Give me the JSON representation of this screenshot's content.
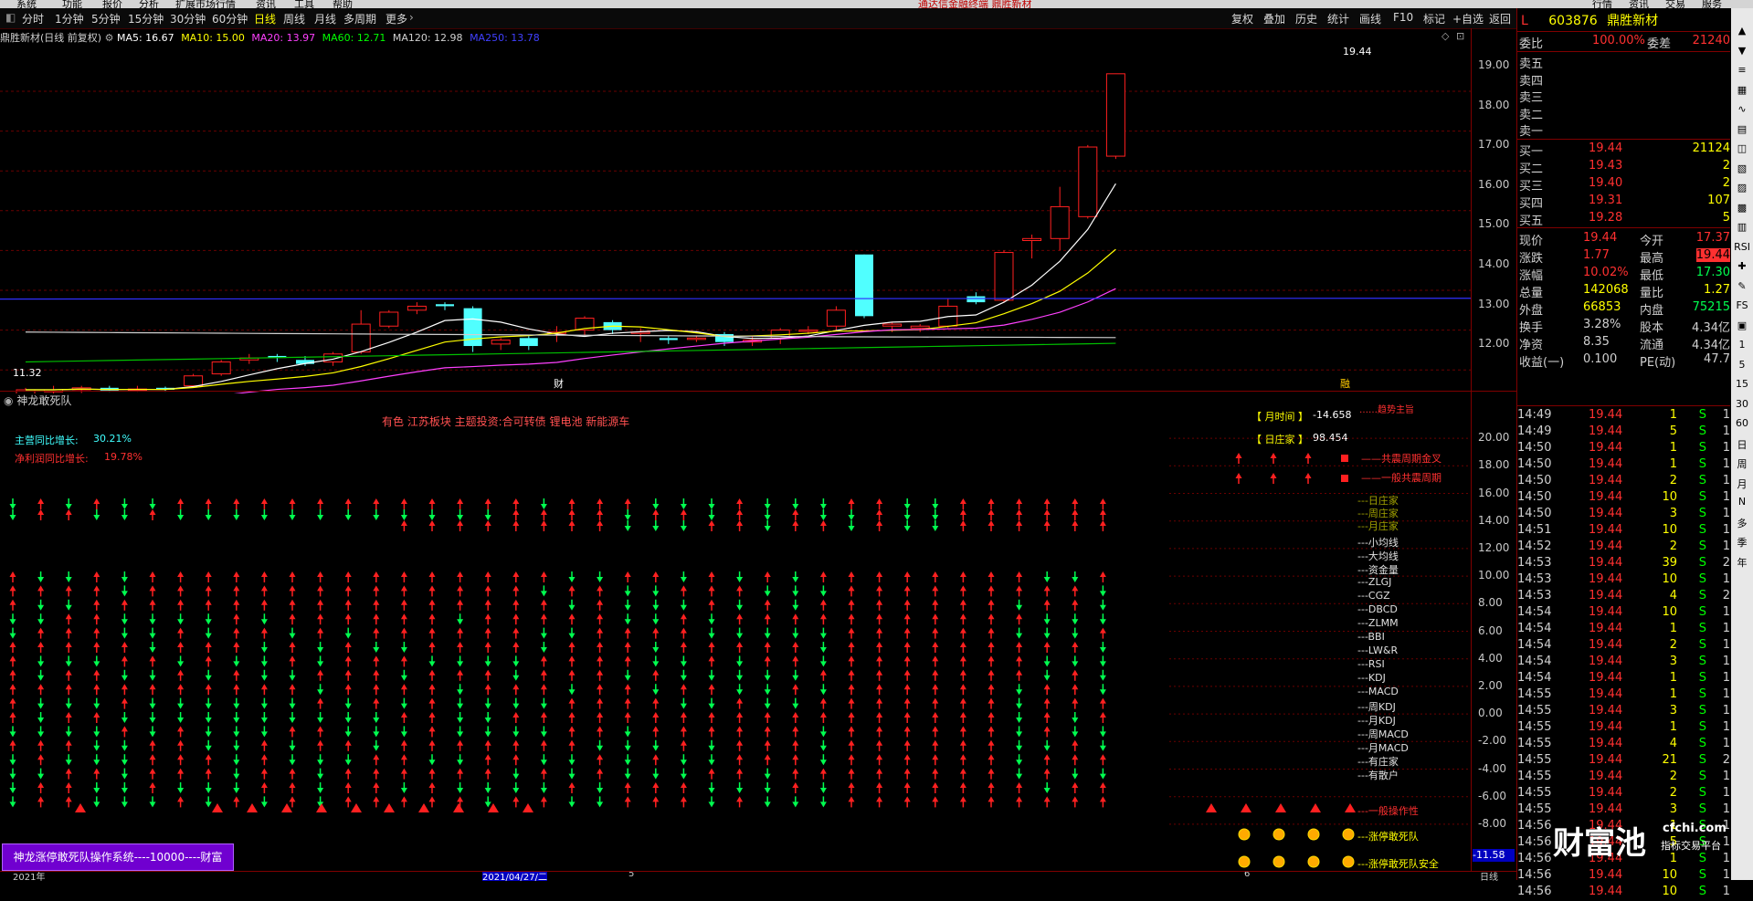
{
  "menu": [
    "系统",
    "功能",
    "报价",
    "分析",
    "扩展市场行情",
    "资讯",
    "工具",
    "帮助"
  ],
  "menu_center": "通达信金融终端 鼎胜新材",
  "menu_right": [
    "行情",
    "资讯",
    "交易",
    "服务"
  ],
  "toolbar": {
    "periods": [
      "分时",
      "1分钟",
      "5分钟",
      "15分钟",
      "30分钟",
      "60分钟",
      "日线",
      "周线",
      "月线",
      "多周期",
      "更多"
    ],
    "active": "日线",
    "right_buttons": [
      "复权",
      "叠加",
      "历史",
      "统计",
      "画线",
      "F10",
      "标记",
      "+自选",
      "返回"
    ]
  },
  "chart_header": {
    "title": "鼎胜新材(日线 前复权)",
    "ma": [
      {
        "label": "MA5: 16.67",
        "color": "#ffffff"
      },
      {
        "label": "MA10: 15.00",
        "color": "#ffff00"
      },
      {
        "label": "MA20: 13.97",
        "color": "#ff40ff"
      },
      {
        "label": "MA60: 12.71",
        "color": "#00ff00"
      },
      {
        "label": "MA120: 12.98",
        "color": "#d0d0d0"
      },
      {
        "label": "MA250: 13.78",
        "color": "#4040ff"
      }
    ]
  },
  "stock": {
    "code": "603876",
    "name": "鼎胜新材",
    "flag": "L"
  },
  "quote": {
    "weibi_label": "委比",
    "weibi": "100.00%",
    "weicha_label": "委差",
    "weicha": "21240",
    "sells": [
      {
        "label": "卖五"
      },
      {
        "label": "卖四"
      },
      {
        "label": "卖三"
      },
      {
        "label": "卖二"
      },
      {
        "label": "卖一"
      }
    ],
    "buys": [
      {
        "label": "买一",
        "price": "19.44",
        "vol": "21124"
      },
      {
        "label": "买二",
        "price": "19.43",
        "vol": "2"
      },
      {
        "label": "买三",
        "price": "19.40",
        "vol": "2"
      },
      {
        "label": "买四",
        "price": "19.31",
        "vol": "107"
      },
      {
        "label": "买五",
        "price": "19.28",
        "vol": "5"
      }
    ],
    "stats": [
      {
        "l1": "现价",
        "v1": "19.44",
        "l2": "今开",
        "v2": "17.37"
      },
      {
        "l1": "涨跌",
        "v1": "1.77",
        "l2": "最高",
        "v2": "19.44"
      },
      {
        "l1": "涨幅",
        "v1": "10.02%",
        "l2": "最低",
        "v2": "17.30"
      },
      {
        "l1": "总量",
        "v1": "142068",
        "l2": "量比",
        "v2": "1.27"
      },
      {
        "l1": "外盘",
        "v1": "66853",
        "l2": "内盘",
        "v2": "75215"
      },
      {
        "l1": "换手",
        "v1": "3.28%",
        "l2": "股本",
        "v2": "4.34亿"
      },
      {
        "l1": "净资",
        "v1": "8.35",
        "l2": "流通",
        "v2": "4.34亿"
      },
      {
        "l1": "收益(一)",
        "v1": "0.100",
        "l2": "PE(动)",
        "v2": "47.7"
      }
    ]
  },
  "ticks": [
    {
      "t": "14:49",
      "p": "19.44",
      "q": "1",
      "s": "S",
      "n": "1"
    },
    {
      "t": "14:49",
      "p": "19.44",
      "q": "5",
      "s": "S",
      "n": "1"
    },
    {
      "t": "14:50",
      "p": "19.44",
      "q": "1",
      "s": "S",
      "n": "1"
    },
    {
      "t": "14:50",
      "p": "19.44",
      "q": "1",
      "s": "S",
      "n": "1"
    },
    {
      "t": "14:50",
      "p": "19.44",
      "q": "2",
      "s": "S",
      "n": "1"
    },
    {
      "t": "14:50",
      "p": "19.44",
      "q": "10",
      "s": "S",
      "n": "1"
    },
    {
      "t": "14:50",
      "p": "19.44",
      "q": "3",
      "s": "S",
      "n": "1"
    },
    {
      "t": "14:51",
      "p": "19.44",
      "q": "10",
      "s": "S",
      "n": "1"
    },
    {
      "t": "14:52",
      "p": "19.44",
      "q": "2",
      "s": "S",
      "n": "1"
    },
    {
      "t": "14:53",
      "p": "19.44",
      "q": "39",
      "s": "S",
      "n": "2"
    },
    {
      "t": "14:53",
      "p": "19.44",
      "q": "10",
      "s": "S",
      "n": "1"
    },
    {
      "t": "14:53",
      "p": "19.44",
      "q": "4",
      "s": "S",
      "n": "2"
    },
    {
      "t": "14:54",
      "p": "19.44",
      "q": "10",
      "s": "S",
      "n": "1"
    },
    {
      "t": "14:54",
      "p": "19.44",
      "q": "1",
      "s": "S",
      "n": "1"
    },
    {
      "t": "14:54",
      "p": "19.44",
      "q": "2",
      "s": "S",
      "n": "1"
    },
    {
      "t": "14:54",
      "p": "19.44",
      "q": "3",
      "s": "S",
      "n": "1"
    },
    {
      "t": "14:54",
      "p": "19.44",
      "q": "1",
      "s": "S",
      "n": "1"
    },
    {
      "t": "14:55",
      "p": "19.44",
      "q": "1",
      "s": "S",
      "n": "1"
    },
    {
      "t": "14:55",
      "p": "19.44",
      "q": "3",
      "s": "S",
      "n": "1"
    },
    {
      "t": "14:55",
      "p": "19.44",
      "q": "1",
      "s": "S",
      "n": "1"
    },
    {
      "t": "14:55",
      "p": "19.44",
      "q": "4",
      "s": "S",
      "n": "1"
    },
    {
      "t": "14:55",
      "p": "19.44",
      "q": "21",
      "s": "S",
      "n": "2"
    },
    {
      "t": "14:55",
      "p": "19.44",
      "q": "2",
      "s": "S",
      "n": "1"
    },
    {
      "t": "14:55",
      "p": "19.44",
      "q": "2",
      "s": "S",
      "n": "1"
    },
    {
      "t": "14:55",
      "p": "19.44",
      "q": "3",
      "s": "S",
      "n": "1"
    },
    {
      "t": "14:56",
      "p": "19.44",
      "q": "1",
      "s": "S",
      "n": "1"
    },
    {
      "t": "14:56",
      "p": "19.44",
      "q": "5",
      "s": "S",
      "n": "1"
    },
    {
      "t": "14:56",
      "p": "19.44",
      "q": "1",
      "s": "S",
      "n": "1"
    },
    {
      "t": "14:56",
      "p": "19.44",
      "q": "10",
      "s": "S",
      "n": "1"
    },
    {
      "t": "14:56",
      "p": "19.44",
      "q": "10",
      "s": "S",
      "n": "1"
    }
  ],
  "sidebar_icons": [
    "▲",
    "▼",
    "≡",
    "▦",
    "∿",
    "▤",
    "◫",
    "▧",
    "▨",
    "▩",
    "▥",
    "RSI",
    "✚",
    "✎",
    "FS",
    "▣",
    "1",
    "5",
    "15",
    "30",
    "60",
    "日",
    "周",
    "月",
    "N",
    "多",
    "季",
    "年"
  ],
  "price_axis": [
    "19.00",
    "18.00",
    "17.00",
    "16.00",
    "15.00",
    "14.00",
    "13.00",
    "12.00"
  ],
  "price_labels": {
    "high": "19.44",
    "low": "11.32",
    "cai": "财",
    "rong": "融"
  },
  "indicator": {
    "title": "神龙敢死队",
    "concepts": "有色 江苏板块 主题投资:合可转债 锂电池 新能源车",
    "yoy_main_label": "主营同比增长:",
    "yoy_main": "30.21%",
    "yoy_profit_label": "净利润同比增长:",
    "yoy_profit": "19.78%",
    "month_time_label": "【 月时间 】",
    "month_time": "-14.658",
    "day_zhuang_label": "【 日庄家 】",
    "day_zhuang": "98.454",
    "top_label": "……趋势主旨",
    "bottom_value": "-11.58",
    "banner": "神龙涨停敢死队操作系统----10000----财富"
  },
  "indicator_axis": [
    "20.00",
    "18.00",
    "16.00",
    "14.00",
    "12.00",
    "10.00",
    "8.00",
    "6.00",
    "4.00",
    "2.00",
    "0.00",
    "-2.00",
    "-4.00",
    "-6.00",
    "-8.00"
  ],
  "legend_rows": [
    {
      "text": "——共震周期金叉",
      "color": "#ff3030"
    },
    {
      "text": "——一般共震周期",
      "color": "#ff3030"
    },
    {
      "text": "---日庄家",
      "color": "#a0a000"
    },
    {
      "text": "---周庄家",
      "color": "#a0a000"
    },
    {
      "text": "---月庄家",
      "color": "#a0a000"
    },
    {
      "text": "---小均线",
      "color": "#e0e0e0"
    },
    {
      "text": "---大均线",
      "color": "#e0e0e0"
    },
    {
      "text": "---资金量",
      "color": "#e0e0e0"
    },
    {
      "text": "---ZLGJ",
      "color": "#e0e0e0"
    },
    {
      "text": "---CGZ",
      "color": "#e0e0e0"
    },
    {
      "text": "---DBCD",
      "color": "#e0e0e0"
    },
    {
      "text": "---ZLMM",
      "color": "#e0e0e0"
    },
    {
      "text": "---BBI",
      "color": "#e0e0e0"
    },
    {
      "text": "---LW&R",
      "color": "#e0e0e0"
    },
    {
      "text": "---RSI",
      "color": "#e0e0e0"
    },
    {
      "text": "---KDJ",
      "color": "#e0e0e0"
    },
    {
      "text": "---MACD",
      "color": "#e0e0e0"
    },
    {
      "text": "---周KDJ",
      "color": "#e0e0e0"
    },
    {
      "text": "---月KDJ",
      "color": "#e0e0e0"
    },
    {
      "text": "---周MACD",
      "color": "#e0e0e0"
    },
    {
      "text": "---月MACD",
      "color": "#e0e0e0"
    },
    {
      "text": "---有庄家",
      "color": "#e0e0e0"
    },
    {
      "text": "---有散户",
      "color": "#e0e0e0"
    },
    {
      "text": "---一般操作性",
      "color": "#ff3030"
    },
    {
      "text": "---涨停敢死队",
      "color": "#ffff00"
    },
    {
      "text": "---涨停敢死队安全",
      "color": "#ffff00"
    }
  ],
  "date_axis": {
    "year": "2021年",
    "cursor": "2021/04/27/二",
    "m5": "5",
    "m6": "6",
    "period": "日线"
  },
  "watermark": {
    "brand": "财富池",
    "site": "cfchi.com",
    "slogan": "指标交易平台"
  },
  "colors": {
    "up": "#ff2020",
    "down": "#00ff50",
    "cyan": "#50ffff",
    "grid": "#6a0000"
  }
}
